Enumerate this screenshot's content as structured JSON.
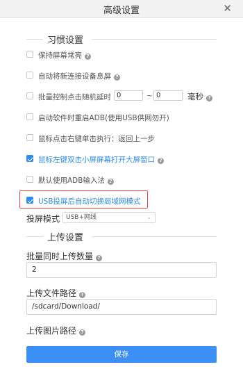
{
  "window": {
    "title": "高级设置",
    "close_glyph": "✕"
  },
  "habits": {
    "heading": "习惯设置",
    "keep_screen_on": {
      "label": "保持屏幕常亮",
      "checked": false
    },
    "auto_sleep_new_device": {
      "label": "自动将新连接设备息屏",
      "checked": false
    },
    "batch_random_delay": {
      "label": "批量控制点击随机延时",
      "checked": false,
      "min": "0",
      "separator": "~",
      "max": "0",
      "unit": "毫秒"
    },
    "restart_adb": {
      "label": "启动软件时重启ADB(使用USB供网勿开)",
      "checked": false
    },
    "right_click_action": {
      "label": "鼠标点击右键单击执行：返回上一步",
      "checked": false
    },
    "double_click_open": {
      "label": "鼠标左键双击小屏屏幕打开大屏窗口",
      "checked": true
    },
    "default_adb_input": {
      "label": "默认使用ADB输入法",
      "checked": false
    },
    "usb_auto_lan": {
      "label": "USB投屏后自动切换局域网模式",
      "checked": true
    }
  },
  "projection": {
    "label": "投屏模式",
    "value": "USB+网线"
  },
  "upload": {
    "heading": "上传设置",
    "batch_count": {
      "label": "批量同时上传数量",
      "value": "2"
    },
    "file_path": {
      "label": "上传文件路径",
      "value": "/sdcard/Download/"
    },
    "image_path": {
      "label": "上传图片路径"
    }
  },
  "save_button": "保存",
  "colors": {
    "accent": "#2d8cf0",
    "button": "#3c8ff5",
    "highlight_border": "#e8423a"
  },
  "icons": {
    "help": "question-circle-icon",
    "close": "close-icon",
    "dropdown": "chevron-down-icon"
  }
}
